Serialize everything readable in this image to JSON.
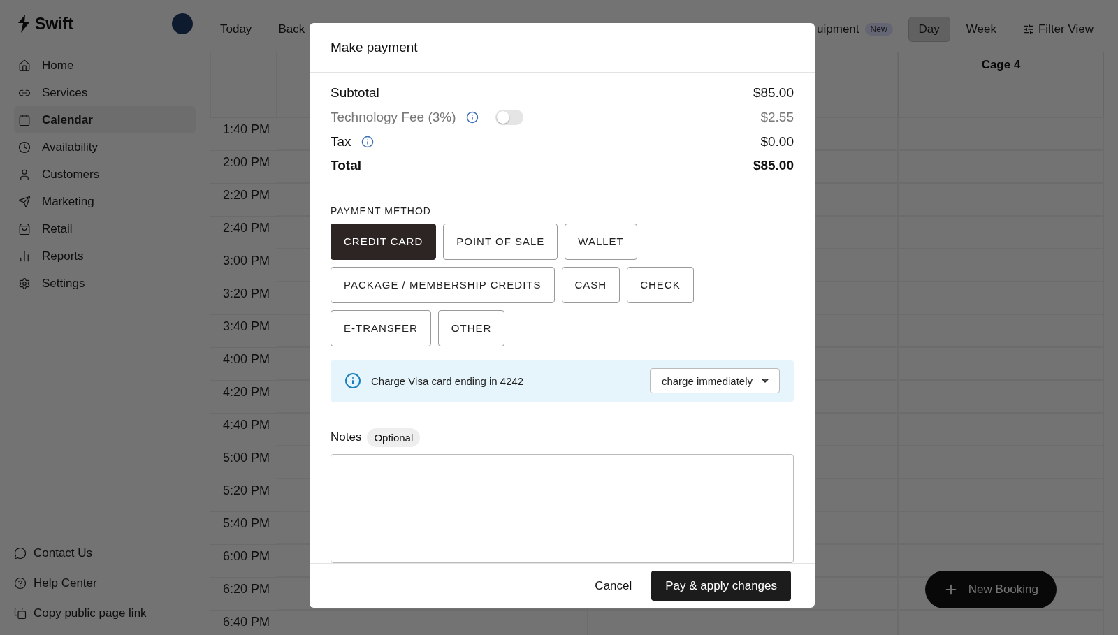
{
  "sidebar": {
    "brand": "Swift",
    "items": [
      {
        "label": "Home",
        "selected": false
      },
      {
        "label": "Services",
        "selected": false
      },
      {
        "label": "Calendar",
        "selected": true
      },
      {
        "label": "Availability",
        "selected": false
      },
      {
        "label": "Customers",
        "selected": false
      },
      {
        "label": "Marketing",
        "selected": false
      },
      {
        "label": "Retail",
        "selected": false
      },
      {
        "label": "Reports",
        "selected": false
      },
      {
        "label": "Settings",
        "selected": false
      }
    ],
    "footer_links": [
      "Contact Us",
      "Help Center",
      "Copy public page link"
    ]
  },
  "toolbar": {
    "buttons": [
      "Today",
      "Back"
    ],
    "equipment_tab": {
      "label": "uipment",
      "badge": "New"
    },
    "views": [
      {
        "label": "Day",
        "selected": true
      },
      {
        "label": "Week",
        "selected": false
      }
    ],
    "filter": "Filter View"
  },
  "calendar": {
    "column_header": "Cage 4",
    "times": [
      "1:40 PM",
      "2:00 PM",
      "2:20 PM",
      "2:40 PM",
      "3:00 PM",
      "3:20 PM",
      "3:40 PM",
      "4:00 PM",
      "4:20 PM",
      "4:40 PM",
      "5:00 PM",
      "5:20 PM",
      "5:40 PM",
      "6:00 PM",
      "6:20 PM",
      "6:40 PM"
    ]
  },
  "fab": "New Booking",
  "modal": {
    "title": "Make payment",
    "rows": [
      {
        "kind": "line",
        "label": "Subtotal",
        "amount": "$85.00"
      },
      {
        "kind": "fee",
        "label": "Technology Fee (3%)",
        "amount": "$2.55",
        "on": false
      },
      {
        "kind": "info",
        "label": "Tax",
        "amount": "$0.00"
      },
      {
        "kind": "total",
        "label": "Total",
        "amount": "$85.00"
      }
    ],
    "payment_method_label": "PAYMENT METHOD",
    "methods": [
      [
        {
          "label": "CREDIT CARD",
          "selected": true
        },
        {
          "label": "POINT OF SALE",
          "selected": false
        },
        {
          "label": "WALLET",
          "selected": false
        }
      ],
      [
        {
          "label": "PACKAGE / MEMBERSHIP CREDITS",
          "selected": false
        },
        {
          "label": "CASH",
          "selected": false
        },
        {
          "label": "CHECK",
          "selected": false
        }
      ],
      [
        {
          "label": "E-TRANSFER",
          "selected": false
        },
        {
          "label": "OTHER",
          "selected": false
        }
      ]
    ],
    "banner": {
      "text": "Charge Visa card ending in 4242",
      "select_value": "charge immediately"
    },
    "notes": {
      "label": "Notes",
      "badge": "Optional"
    },
    "actions": {
      "cancel": "Cancel",
      "confirm": "Pay & apply changes"
    }
  }
}
